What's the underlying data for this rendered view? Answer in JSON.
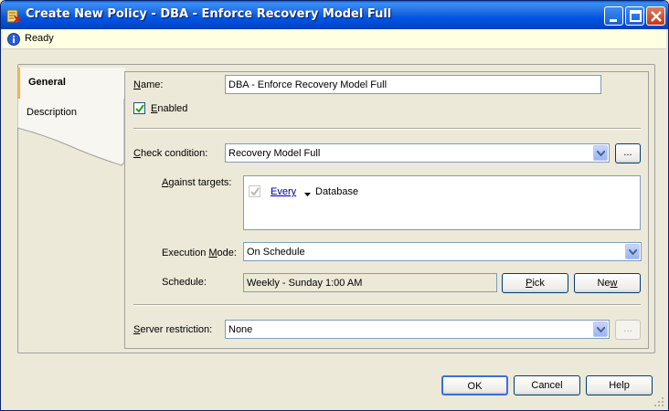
{
  "window": {
    "title": "Create New Policy - DBA - Enforce Recovery Model Full"
  },
  "status": {
    "text": "Ready"
  },
  "tabs": [
    {
      "label": "General"
    },
    {
      "label": "Description"
    }
  ],
  "general": {
    "name_label_u": "N",
    "name_label_rest": "ame:",
    "name_value": "DBA - Enforce Recovery Model Full",
    "enabled_label_u": "E",
    "enabled_label_rest": "nabled",
    "check_condition_label_u": "C",
    "check_condition_label_rest": "heck condition:",
    "check_condition_value": "Recovery Model Full",
    "browse_label": "...",
    "against_targets_label_u": "A",
    "against_targets_label_rest": "gainst targets:",
    "target_link": "Every",
    "target_object": "Database",
    "execution_mode_label_pre": "Execution ",
    "execution_mode_label_u": "M",
    "execution_mode_label_rest": "ode:",
    "execution_mode_value": "On Schedule",
    "schedule_label": "Schedule:",
    "schedule_value": "Weekly - Sunday 1:00 AM",
    "pick_label_u": "P",
    "pick_label_rest": "ick",
    "new_label_pre": "Ne",
    "new_label_u": "w",
    "server_restriction_label_u": "S",
    "server_restriction_label_rest": "erver restriction:",
    "server_restriction_value": "None",
    "server_browse_label": "..."
  },
  "footer": {
    "ok_label": "OK",
    "cancel_label": "Cancel",
    "help_label": "Help"
  },
  "colors": {
    "titlebar": "#0055E5",
    "status_background": "#FFFFE1",
    "tab_accent": "#F2B24B",
    "face": "#ECE9D8"
  }
}
